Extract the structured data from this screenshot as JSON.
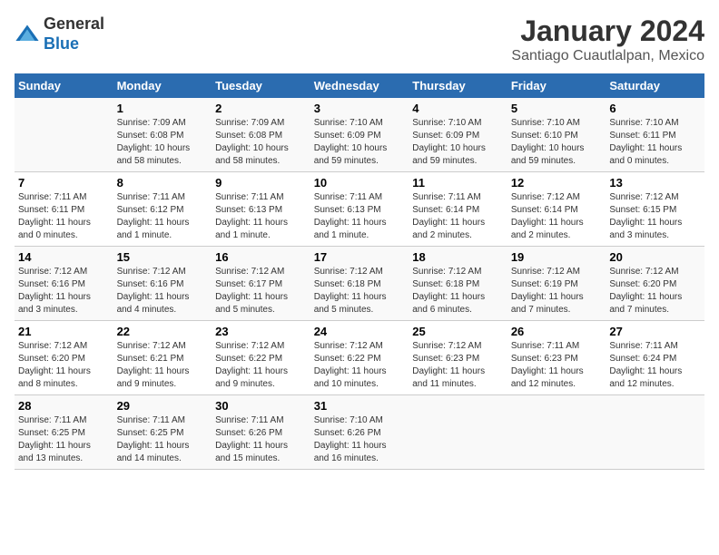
{
  "logo": {
    "text_general": "General",
    "text_blue": "Blue"
  },
  "title": "January 2024",
  "subtitle": "Santiago Cuautlalpan, Mexico",
  "days_of_week": [
    "Sunday",
    "Monday",
    "Tuesday",
    "Wednesday",
    "Thursday",
    "Friday",
    "Saturday"
  ],
  "weeks": [
    [
      {
        "day": "",
        "info": ""
      },
      {
        "day": "1",
        "info": "Sunrise: 7:09 AM\nSunset: 6:08 PM\nDaylight: 10 hours\nand 58 minutes."
      },
      {
        "day": "2",
        "info": "Sunrise: 7:09 AM\nSunset: 6:08 PM\nDaylight: 10 hours\nand 58 minutes."
      },
      {
        "day": "3",
        "info": "Sunrise: 7:10 AM\nSunset: 6:09 PM\nDaylight: 10 hours\nand 59 minutes."
      },
      {
        "day": "4",
        "info": "Sunrise: 7:10 AM\nSunset: 6:09 PM\nDaylight: 10 hours\nand 59 minutes."
      },
      {
        "day": "5",
        "info": "Sunrise: 7:10 AM\nSunset: 6:10 PM\nDaylight: 10 hours\nand 59 minutes."
      },
      {
        "day": "6",
        "info": "Sunrise: 7:10 AM\nSunset: 6:11 PM\nDaylight: 11 hours\nand 0 minutes."
      }
    ],
    [
      {
        "day": "7",
        "info": "Sunrise: 7:11 AM\nSunset: 6:11 PM\nDaylight: 11 hours\nand 0 minutes."
      },
      {
        "day": "8",
        "info": "Sunrise: 7:11 AM\nSunset: 6:12 PM\nDaylight: 11 hours\nand 1 minute."
      },
      {
        "day": "9",
        "info": "Sunrise: 7:11 AM\nSunset: 6:13 PM\nDaylight: 11 hours\nand 1 minute."
      },
      {
        "day": "10",
        "info": "Sunrise: 7:11 AM\nSunset: 6:13 PM\nDaylight: 11 hours\nand 1 minute."
      },
      {
        "day": "11",
        "info": "Sunrise: 7:11 AM\nSunset: 6:14 PM\nDaylight: 11 hours\nand 2 minutes."
      },
      {
        "day": "12",
        "info": "Sunrise: 7:12 AM\nSunset: 6:14 PM\nDaylight: 11 hours\nand 2 minutes."
      },
      {
        "day": "13",
        "info": "Sunrise: 7:12 AM\nSunset: 6:15 PM\nDaylight: 11 hours\nand 3 minutes."
      }
    ],
    [
      {
        "day": "14",
        "info": "Sunrise: 7:12 AM\nSunset: 6:16 PM\nDaylight: 11 hours\nand 3 minutes."
      },
      {
        "day": "15",
        "info": "Sunrise: 7:12 AM\nSunset: 6:16 PM\nDaylight: 11 hours\nand 4 minutes."
      },
      {
        "day": "16",
        "info": "Sunrise: 7:12 AM\nSunset: 6:17 PM\nDaylight: 11 hours\nand 5 minutes."
      },
      {
        "day": "17",
        "info": "Sunrise: 7:12 AM\nSunset: 6:18 PM\nDaylight: 11 hours\nand 5 minutes."
      },
      {
        "day": "18",
        "info": "Sunrise: 7:12 AM\nSunset: 6:18 PM\nDaylight: 11 hours\nand 6 minutes."
      },
      {
        "day": "19",
        "info": "Sunrise: 7:12 AM\nSunset: 6:19 PM\nDaylight: 11 hours\nand 7 minutes."
      },
      {
        "day": "20",
        "info": "Sunrise: 7:12 AM\nSunset: 6:20 PM\nDaylight: 11 hours\nand 7 minutes."
      }
    ],
    [
      {
        "day": "21",
        "info": "Sunrise: 7:12 AM\nSunset: 6:20 PM\nDaylight: 11 hours\nand 8 minutes."
      },
      {
        "day": "22",
        "info": "Sunrise: 7:12 AM\nSunset: 6:21 PM\nDaylight: 11 hours\nand 9 minutes."
      },
      {
        "day": "23",
        "info": "Sunrise: 7:12 AM\nSunset: 6:22 PM\nDaylight: 11 hours\nand 9 minutes."
      },
      {
        "day": "24",
        "info": "Sunrise: 7:12 AM\nSunset: 6:22 PM\nDaylight: 11 hours\nand 10 minutes."
      },
      {
        "day": "25",
        "info": "Sunrise: 7:12 AM\nSunset: 6:23 PM\nDaylight: 11 hours\nand 11 minutes."
      },
      {
        "day": "26",
        "info": "Sunrise: 7:11 AM\nSunset: 6:23 PM\nDaylight: 11 hours\nand 12 minutes."
      },
      {
        "day": "27",
        "info": "Sunrise: 7:11 AM\nSunset: 6:24 PM\nDaylight: 11 hours\nand 12 minutes."
      }
    ],
    [
      {
        "day": "28",
        "info": "Sunrise: 7:11 AM\nSunset: 6:25 PM\nDaylight: 11 hours\nand 13 minutes."
      },
      {
        "day": "29",
        "info": "Sunrise: 7:11 AM\nSunset: 6:25 PM\nDaylight: 11 hours\nand 14 minutes."
      },
      {
        "day": "30",
        "info": "Sunrise: 7:11 AM\nSunset: 6:26 PM\nDaylight: 11 hours\nand 15 minutes."
      },
      {
        "day": "31",
        "info": "Sunrise: 7:10 AM\nSunset: 6:26 PM\nDaylight: 11 hours\nand 16 minutes."
      },
      {
        "day": "",
        "info": ""
      },
      {
        "day": "",
        "info": ""
      },
      {
        "day": "",
        "info": ""
      }
    ]
  ]
}
